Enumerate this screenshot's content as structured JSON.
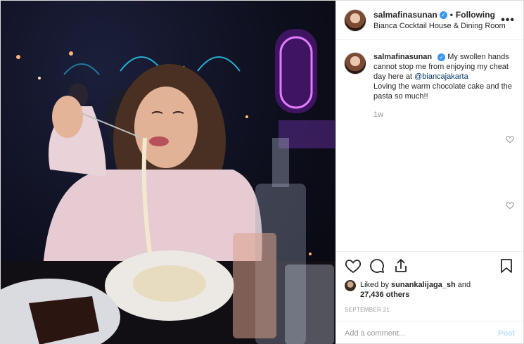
{
  "post": {
    "username": "salmafinasunan",
    "verified_mark": "✓",
    "separator": "•",
    "follow_label": "Following",
    "location": "Bianca Cocktail House & Dining Room",
    "more_label": "•••"
  },
  "caption": {
    "username": "salmafinasunan",
    "text_before": "My swollen hands cannot stop me from enjoying my cheat day here at ",
    "mention": "@biancajakarta",
    "text_after": "Loving the warm chocolate cake and the pasta so much!!",
    "time": "1w"
  },
  "icons": {
    "like": "heart-icon",
    "comment": "comment-icon",
    "share": "share-icon",
    "save": "bookmark-icon",
    "more": "more-icon",
    "verified": "verified-badge-icon"
  },
  "likes": {
    "prefix": "Liked by ",
    "user": "sunankalijaga_sh",
    "and": " and",
    "count": "27,436 others"
  },
  "date": "SEPTEMBER 21",
  "comment_box": {
    "placeholder": "Add a comment...",
    "post_label": "Post"
  },
  "colors": {
    "verified": "#3897f0",
    "mention": "#003569",
    "post_disabled": "#b2dffc",
    "neon": "#c44cff"
  }
}
